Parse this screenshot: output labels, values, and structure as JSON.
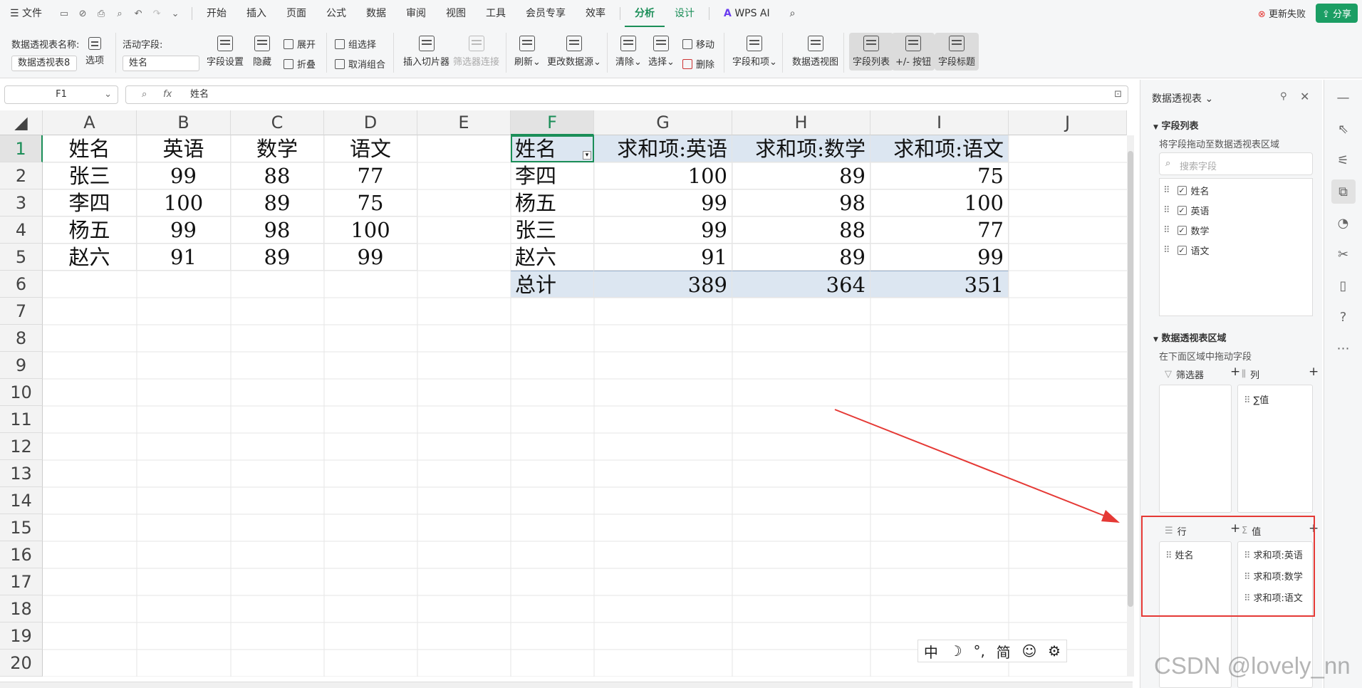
{
  "menubar": {
    "file": "文件",
    "items": [
      "开始",
      "插入",
      "页面",
      "公式",
      "数据",
      "审阅",
      "视图",
      "工具",
      "会员专享",
      "效率"
    ],
    "active_tab": "分析",
    "design_tab": "设计",
    "wps_ai": "WPS AI",
    "sync_status": "更新失败",
    "share": "分享"
  },
  "ribbon": {
    "pivot_name_label": "数据透视表名称:",
    "pivot_name_value": "数据透视表8",
    "options": "选项",
    "active_field_label": "活动字段:",
    "active_field_value": "姓名",
    "field_settings": "字段设置",
    "hide": "隐藏",
    "expand": "展开",
    "collapse": "折叠",
    "group_select": "组选择",
    "ungroup": "取消组合",
    "insert_slicer": "插入切片器",
    "filter_conn": "筛选器连接",
    "refresh": "刷新",
    "change_source": "更改数据源",
    "clear": "清除",
    "select": "选择",
    "move": "移动",
    "delete": "删除",
    "fields_items": "字段和项",
    "pivot_chart": "数据透视图",
    "field_list": "字段列表",
    "buttons": "+/- 按钮",
    "field_headers": "字段标题"
  },
  "formula_bar": {
    "cell_ref": "F1",
    "fx": "fx",
    "content": "姓名"
  },
  "sheet": {
    "columns": [
      "A",
      "B",
      "C",
      "D",
      "E",
      "F",
      "G",
      "H",
      "I",
      "J"
    ],
    "rows": [
      "1",
      "2",
      "3",
      "4",
      "5",
      "6",
      "7",
      "8",
      "9",
      "10",
      "11",
      "12",
      "13",
      "14",
      "15",
      "16",
      "17",
      "18",
      "19",
      "20"
    ],
    "source_headers": [
      "姓名",
      "英语",
      "数学",
      "语文"
    ],
    "source_rows": [
      [
        "张三",
        "99",
        "88",
        "77"
      ],
      [
        "李四",
        "100",
        "89",
        "75"
      ],
      [
        "杨五",
        "99",
        "98",
        "100"
      ],
      [
        "赵六",
        "91",
        "89",
        "99"
      ]
    ],
    "pivot_headers": [
      "姓名",
      "求和项:英语",
      "求和项:数学",
      "求和项:语文"
    ],
    "pivot_rows": [
      [
        "李四",
        "100",
        "89",
        "75"
      ],
      [
        "杨五",
        "99",
        "98",
        "100"
      ],
      [
        "张三",
        "99",
        "88",
        "77"
      ],
      [
        "赵六",
        "91",
        "89",
        "99"
      ]
    ],
    "pivot_total": [
      "总计",
      "389",
      "364",
      "351"
    ]
  },
  "panel": {
    "title": "数据透视表",
    "field_list_title": "字段列表",
    "field_list_hint": "将字段拖动至数据透视表区域",
    "search_placeholder": "搜索字段",
    "fields": [
      "姓名",
      "英语",
      "数学",
      "语文"
    ],
    "areas_title": "数据透视表区域",
    "areas_hint": "在下面区域中拖动字段",
    "filter_label": "筛选器",
    "column_label": "列",
    "column_items": [
      "∑值"
    ],
    "row_label": "行",
    "row_items": [
      "姓名"
    ],
    "value_label": "值",
    "value_items": [
      "求和项:英语",
      "求和项:数学",
      "求和项:语文"
    ]
  },
  "ime": {
    "items": [
      "中",
      "☽",
      "°,",
      "简",
      "☺",
      "⚙"
    ]
  },
  "watermark": "CSDN @lovely_nn",
  "colors": {
    "accent": "#1b8e58",
    "pivot_header": "#dce6f1",
    "annotation": "#e53935"
  }
}
